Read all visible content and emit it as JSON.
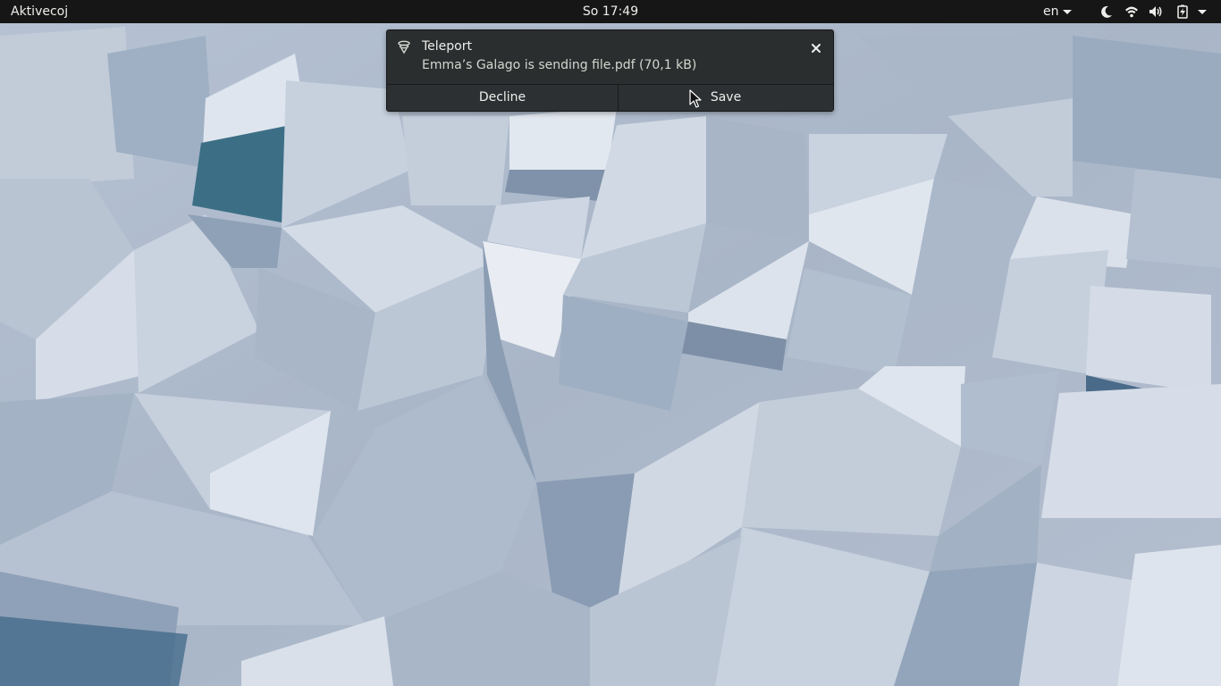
{
  "topbar": {
    "activities_label": "Aktivecoj",
    "clock": "So 17:49",
    "language": "en",
    "icons": [
      "chevron-down-icon",
      "night-light-icon",
      "wifi-icon",
      "volume-icon",
      "battery-charging-icon",
      "chevron-down-icon"
    ]
  },
  "notification": {
    "app_name": "Teleport",
    "body": "Emma’s Galago is sending file.pdf (70,1 kB)",
    "icon": "teleport-app-icon",
    "close_icon": "close-icon",
    "actions": {
      "decline_label": "Decline",
      "save_label": "Save"
    }
  },
  "colors": {
    "topbar_bg": "#161616",
    "notification_bg": "#2b2e2f",
    "text": "#eeeeec",
    "wallpaper_base": "#aebccd"
  }
}
